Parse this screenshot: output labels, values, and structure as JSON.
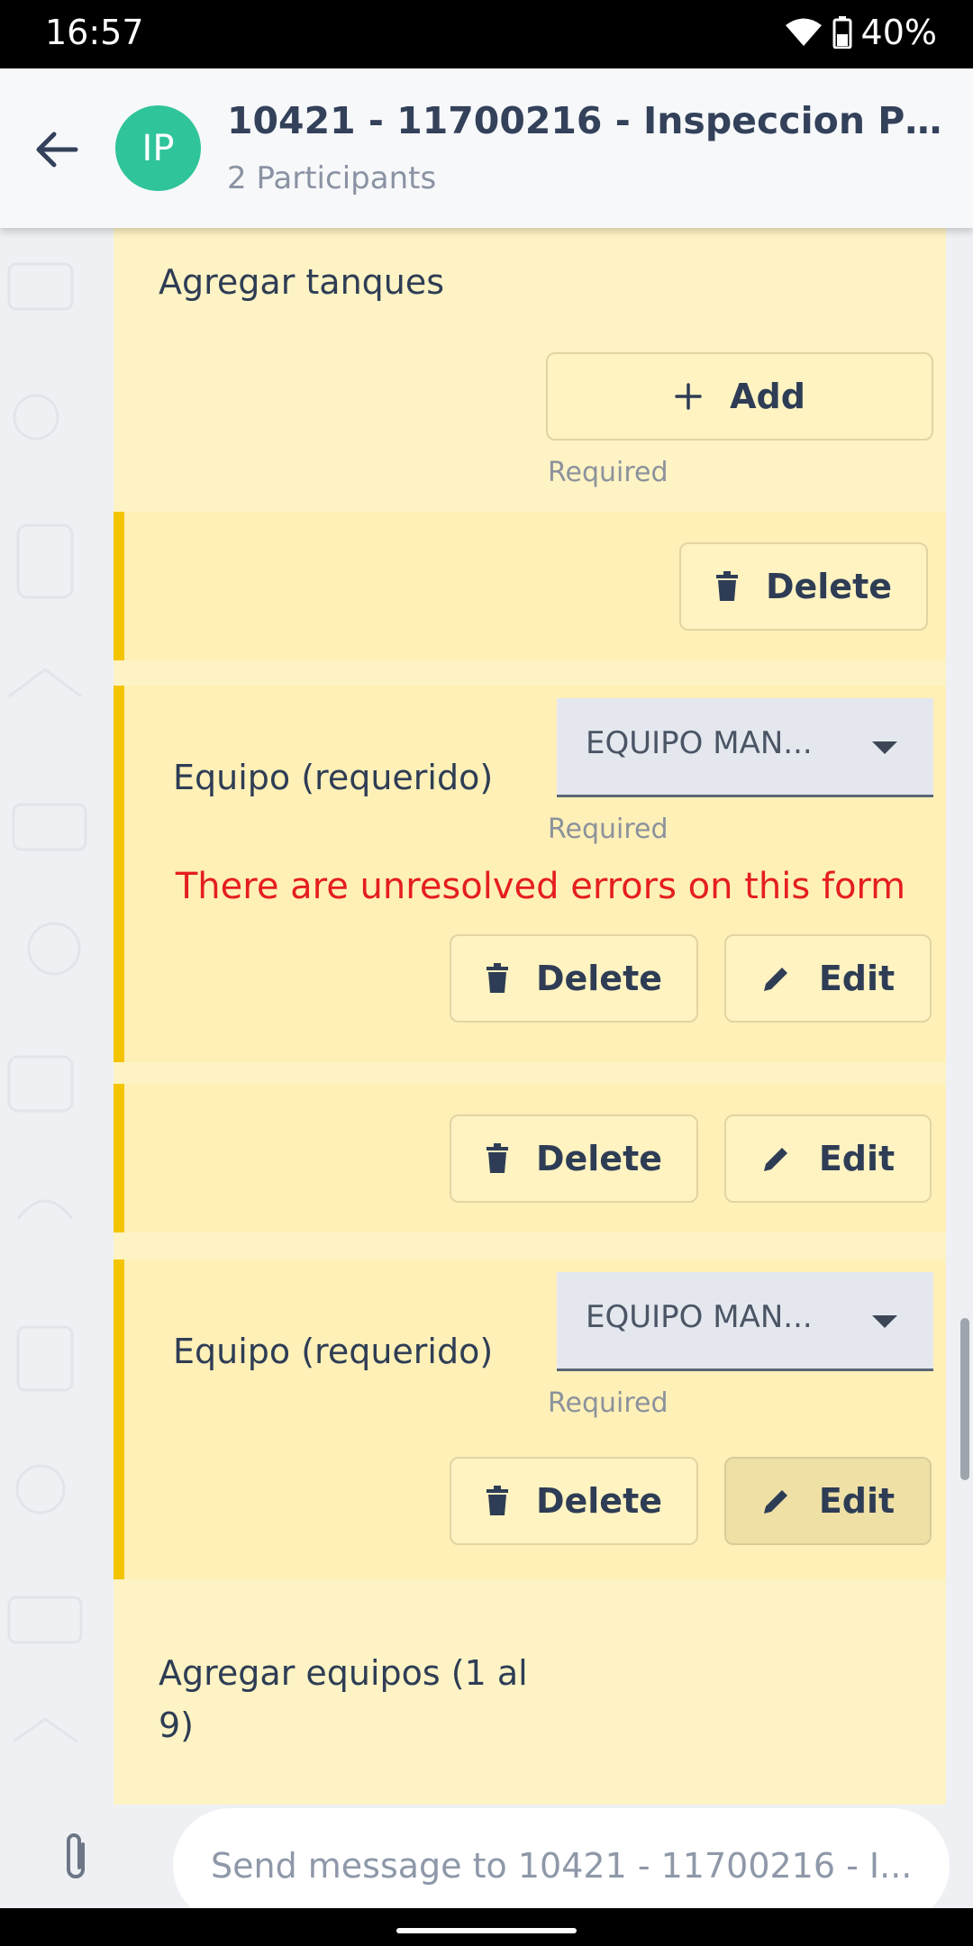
{
  "status_bar": {
    "time": "16:57",
    "battery": "40%"
  },
  "header": {
    "avatar_initials": "IP",
    "title": "10421 - 11700216 - Inspeccion Preve...",
    "subtitle": "2 Participants"
  },
  "form": {
    "agregar_tanques_label": "Agregar tanques",
    "add_button": "Add",
    "required_text": "Required",
    "delete_button": "Delete",
    "edit_button": "Edit",
    "equipo_label": "Equipo (requerido)",
    "equipo_value": "EQUIPO MAN...",
    "error_message": "There are unresolved errors on this form",
    "agregar_equipos_label": "Agregar equipos (1 al 9)"
  },
  "composer": {
    "placeholder": "Send message to 10421 - 11700216 - I..."
  },
  "colors": {
    "accent_bar": "#f5c400",
    "avatar": "#2fc49a",
    "error": "#e51e1e",
    "card": "#fef3c4"
  }
}
